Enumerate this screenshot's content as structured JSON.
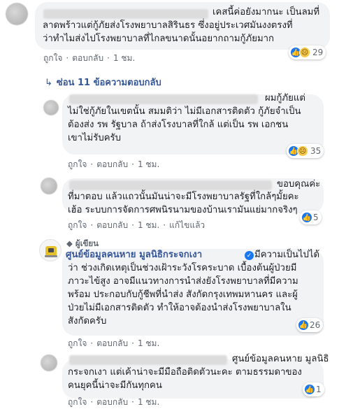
{
  "comments": [
    {
      "lines": [
        "เคสนี้ค่อยังมากนะ เป็นลมที่",
        "ลาดพร้าวแต่กู้ภัยส่งโรงพยาบาลสิรินธร ซึ่งอยู่ประเวศมันงงตรงที่",
        "ว่าทำไมส่งไปโรงพยาบาลที่ไกลขนาดนั้นอยากถามกู้ภัยมาก"
      ],
      "actions": [
        "ถูกใจ",
        "ตอบกลับ",
        "1 ชม."
      ],
      "reaction_count": "29"
    }
  ],
  "replies_toggle": "ซ่อน 11 ข้อความตอบกลับ",
  "replies": [
    {
      "lines": [
        "ผมกู้ภัยแต่",
        "ไม่ใช่กู้ภัยในเขตนั้น สมมติว่า ไม่มีเอกสารติดตัว กู้ภัยจำเป็น",
        "ต้องส่ง รพ รัฐบาล ถ้าส่งโรงบาลที่ใกล้ แต่เป็น รพ เอกชน",
        "เขาไม่รับครับ"
      ],
      "actions": [
        "ถูกใจ",
        "ตอบกลับ",
        "1 ชม."
      ],
      "reaction_count": "35"
    },
    {
      "lines": [
        "ขอบคุณค่ะ",
        "ที่มาตอบ แล้วแถวนั้นมันน่าจะมีโรงพยาบาลรัฐที่ใกล้ๆมั้ยคะ",
        "เฮ้อ ระบบการจัดการศพนิรนามของบ้านเรามันแย่มากจริงๆ"
      ],
      "actions": [
        "ถูกใจ",
        "ตอบกลับ",
        "1 ชม.",
        "แก้ไขแล้ว"
      ],
      "reaction_count": "5"
    },
    {
      "badge": "ผู้เขียน",
      "author": "ศูนย์ข้อมูลคนหาย มูลนิธิกระจกเงา",
      "lines": [
        "มีความเป็นไปได้",
        "ว่า ช่วงเกิดเหตุเป็นช่วงเฝ้าระวังโรคระบาด เบื้องต้นผู้ป่วยมี",
        "ภาวะไข้สูง อาจมีแนวทางการนำส่งยังโรงพยาบาลที่มีความ",
        "พร้อม ประกอบกับกู้ชีพที่นำส่ง สังกัดกรุงเทพมหานคร และผู้",
        "ป่วยไม่มีเอกสารติดตัว ทำให้อาจต้องนำส่งโรงพยาบาลใน",
        "สังกัดครับ"
      ],
      "actions": [
        "ถูกใจ",
        "ตอบกลับ",
        "1 ชม."
      ],
      "reaction_count": "26"
    },
    {
      "mention": "ศูนย์ข้อมูลคนหาย มูลนิธิ",
      "lines": [
        "กระจกเงา แต่เค้าน่าจะมีมือถือติดตัวนะคะ ตามธรรมดาของ",
        "คนยุคนี้น่าจะมีกันทุกคน"
      ],
      "actions": [
        "ถูกใจ",
        "ตอบกลับ",
        "1 ชม."
      ],
      "reaction_count": "1"
    }
  ],
  "colors": {
    "link": "#385898",
    "bubble": "#f2f3f5",
    "like": "#1877f2",
    "sad": "#f7c94a"
  },
  "icons": {
    "like": "thumbs-up-icon",
    "sad": "sad-face-icon",
    "reply_arrow": "reply-arrow-icon",
    "author": "author-shield-icon"
  }
}
